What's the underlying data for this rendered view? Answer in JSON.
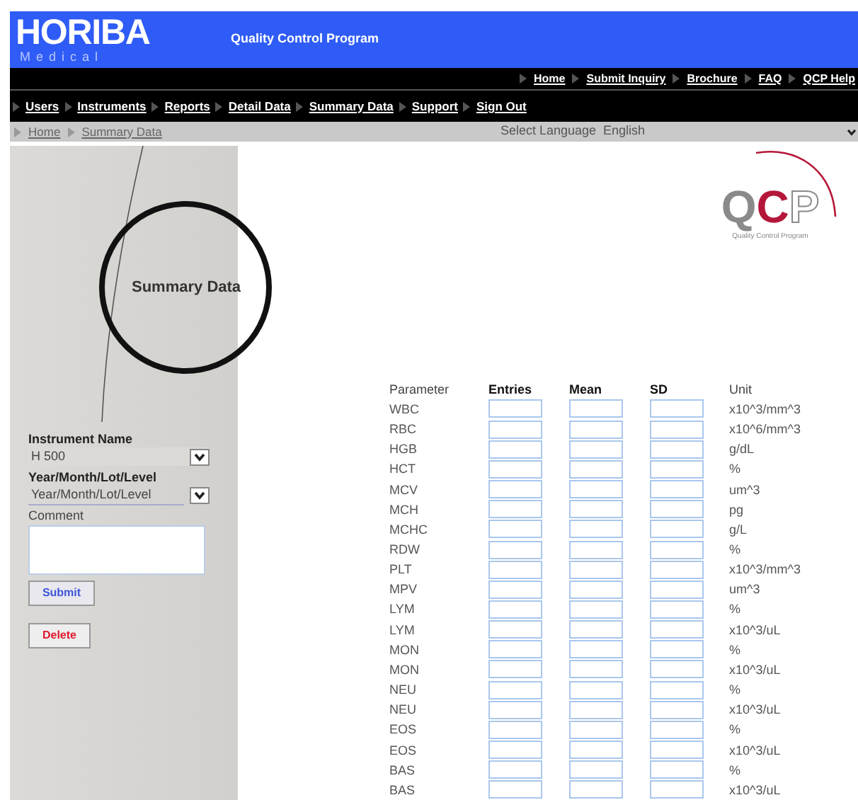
{
  "header": {
    "brand": "HORIBA",
    "brand_sub": "Medical",
    "program": "Quality Control Program"
  },
  "top_links": [
    "Home",
    "Submit Inquiry",
    "Brochure",
    "FAQ",
    "QCP Help"
  ],
  "nav": [
    "Users",
    "Instruments",
    "Reports",
    "Detail Data",
    "Summary Data",
    "Support",
    "Sign Out"
  ],
  "breadcrumb": [
    "Home",
    "Summary Data"
  ],
  "language": {
    "label": "Select Language",
    "value": "English"
  },
  "page_title": "Summary Data",
  "form": {
    "instrument_label": "Instrument Name",
    "instrument_value": "H 500",
    "period_label": "Year/Month/Lot/Level",
    "period_value": "Year/Month/Lot/Level",
    "comment_label": "Comment",
    "submit": "Submit",
    "delete": "Delete"
  },
  "logo": {
    "letters": [
      "Q",
      "C",
      "P"
    ],
    "tagline": "Quality Control Program"
  },
  "table": {
    "columns": [
      "Parameter",
      "Entries",
      "Mean",
      "SD",
      "Unit"
    ],
    "rows": [
      {
        "parameter": "WBC",
        "unit": "x10^3/mm^3"
      },
      {
        "parameter": "RBC",
        "unit": "x10^6/mm^3"
      },
      {
        "parameter": "HGB",
        "unit": "g/dL"
      },
      {
        "parameter": "HCT",
        "unit": "%"
      },
      {
        "parameter": "MCV",
        "unit": "um^3"
      },
      {
        "parameter": "MCH",
        "unit": "pg"
      },
      {
        "parameter": "MCHC",
        "unit": "g/L"
      },
      {
        "parameter": "RDW",
        "unit": "%"
      },
      {
        "parameter": "PLT",
        "unit": "x10^3/mm^3"
      },
      {
        "parameter": "MPV",
        "unit": "um^3"
      },
      {
        "parameter": "LYM",
        "unit": "%"
      },
      {
        "parameter": "LYM",
        "unit": "x10^3/uL"
      },
      {
        "parameter": "MON",
        "unit": "%"
      },
      {
        "parameter": "MON",
        "unit": "x10^3/uL"
      },
      {
        "parameter": "NEU",
        "unit": "%"
      },
      {
        "parameter": "NEU",
        "unit": "x10^3/uL"
      },
      {
        "parameter": "EOS",
        "unit": "%"
      },
      {
        "parameter": "EOS",
        "unit": "x10^3/uL"
      },
      {
        "parameter": "BAS",
        "unit": "%"
      },
      {
        "parameter": "BAS",
        "unit": "x10^3/uL"
      }
    ]
  }
}
